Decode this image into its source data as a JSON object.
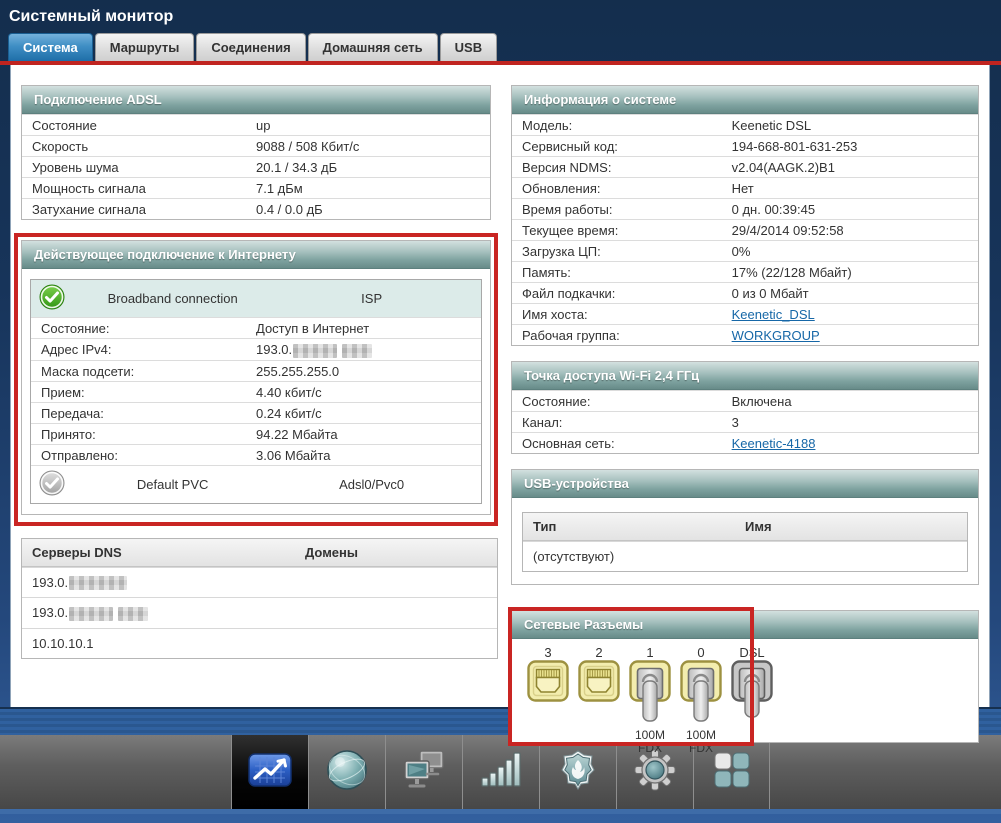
{
  "header": {
    "title": "Системный монитор"
  },
  "tabs": [
    {
      "label": "Система",
      "active": true
    },
    {
      "label": "Маршруты",
      "active": false
    },
    {
      "label": "Соединения",
      "active": false
    },
    {
      "label": "Домашняя сеть",
      "active": false
    },
    {
      "label": "USB",
      "active": false
    }
  ],
  "adsl": {
    "title": "Подключение ADSL",
    "rows": [
      {
        "label": "Состояние",
        "value": "up"
      },
      {
        "label": "Скорость",
        "value": "9088 / 508 Кбит/с"
      },
      {
        "label": "Уровень шума",
        "value": "20.1 / 34.3 дБ"
      },
      {
        "label": "Мощность сигнала",
        "value": "7.1 дБм"
      },
      {
        "label": "Затухание сигнала",
        "value": "0.4 / 0.0 дБ"
      }
    ]
  },
  "internet": {
    "title": "Действующее подключение к Интернету",
    "connection_name": "Broadband connection",
    "connection_type": "ISP",
    "rows": [
      {
        "label": "Состояние:",
        "value": "Доступ в Интернет"
      },
      {
        "label": "Адрес IPv4:",
        "value": "193.0."
      },
      {
        "label": "Маска подсети:",
        "value": "255.255.255.0"
      },
      {
        "label": "Прием:",
        "value": "4.40 кбит/с"
      },
      {
        "label": "Передача:",
        "value": "0.24 кбит/с"
      },
      {
        "label": "Принято:",
        "value": "94.22 Мбайта"
      },
      {
        "label": "Отправлено:",
        "value": "3.06 Мбайта"
      }
    ],
    "footer_name": "Default PVC",
    "footer_value": "Adsl0/Pvc0"
  },
  "dns": {
    "col_servers": "Серверы DNS",
    "col_domains": "Домены",
    "rows": [
      {
        "value": "193.0.",
        "blurred": true
      },
      {
        "value": "193.0.",
        "blurred": true
      },
      {
        "value": "10.10.10.1",
        "blurred": false
      }
    ]
  },
  "system_info": {
    "title": "Информация о системе",
    "rows": [
      {
        "label": "Модель:",
        "value": "Keenetic DSL"
      },
      {
        "label": "Сервисный код:",
        "value": "194-668-801-631-253"
      },
      {
        "label": "Версия NDMS:",
        "value": "v2.04(AAGK.2)B1"
      },
      {
        "label": "Обновления:",
        "value": "Нет"
      },
      {
        "label": "Время работы:",
        "value": "0 дн. 00:39:45"
      },
      {
        "label": "Текущее время:",
        "value": "29/4/2014 09:52:58"
      },
      {
        "label": "Загрузка ЦП:",
        "value": "0%"
      },
      {
        "label": "Память:",
        "value": "17% (22/128 Мбайт)"
      },
      {
        "label": "Файл подкачки:",
        "value": "0 из 0 Мбайт"
      },
      {
        "label": "Имя хоста:",
        "value": "Keenetic_DSL",
        "link": true
      },
      {
        "label": "Рабочая группа:",
        "value": "WORKGROUP",
        "link": true
      }
    ]
  },
  "wifi": {
    "title": "Точка доступа Wi-Fi 2,4 ГГц",
    "rows": [
      {
        "label": "Состояние:",
        "value": "Включена"
      },
      {
        "label": "Канал:",
        "value": "3"
      },
      {
        "label": "Основная сеть:",
        "value": "Keenetic-4188",
        "link": true
      }
    ]
  },
  "usb": {
    "title": "USB-устройства",
    "col_type": "Тип",
    "col_name": "Имя",
    "empty_text": "(отсутствуют)"
  },
  "ports": {
    "title": "Сетевые Разъемы",
    "items": [
      {
        "label": "3",
        "type": "ethernet",
        "connected": false
      },
      {
        "label": "2",
        "type": "ethernet",
        "connected": false
      },
      {
        "label": "1",
        "type": "ethernet",
        "connected": true,
        "speed1": "100M",
        "speed2": "FDX"
      },
      {
        "label": "0",
        "type": "ethernet",
        "connected": true,
        "speed1": "100M",
        "speed2": "FDX"
      },
      {
        "label": "DSL",
        "type": "dsl",
        "connected": true
      }
    ]
  },
  "toolbar": {
    "items": [
      {
        "name": "system-monitor",
        "selected": true
      },
      {
        "name": "internet",
        "selected": false
      },
      {
        "name": "home-network",
        "selected": false
      },
      {
        "name": "wifi",
        "selected": false
      },
      {
        "name": "security",
        "selected": false
      },
      {
        "name": "system-settings",
        "selected": false
      },
      {
        "name": "applications",
        "selected": false
      }
    ]
  },
  "colors": {
    "highlight_red": "#c92523",
    "panel_header_teal": "#7fa3a0",
    "background_navy": "#17345a",
    "link_blue": "#1667a7",
    "active_tab_blue": "#2e7cb5"
  }
}
